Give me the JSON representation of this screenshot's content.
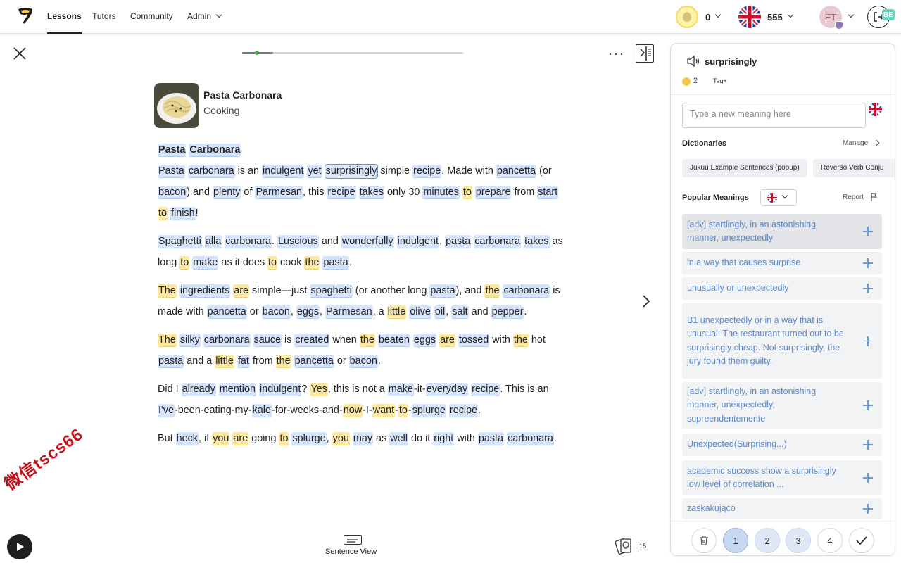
{
  "topbar": {
    "nav": [
      "Lessons",
      "Tutors",
      "Community",
      "Admin"
    ],
    "coins": "0",
    "known_words": "555",
    "avatar_initials": "ET",
    "extension_badge": "BE"
  },
  "lesson": {
    "title": "Pasta Carbonara",
    "category": "Cooking",
    "progress_fraction": 0.14,
    "paragraphs": [
      {
        "heading": true,
        "words": [
          [
            "Pasta",
            "b"
          ],
          [
            " ",
            ""
          ],
          [
            "Carbonara",
            "b"
          ]
        ]
      },
      {
        "words": [
          [
            "Pasta",
            "b"
          ],
          [
            " ",
            ""
          ],
          [
            "carbonara",
            "b"
          ],
          [
            " is an ",
            ""
          ],
          [
            "indulgent",
            "b"
          ],
          [
            " ",
            ""
          ],
          [
            "yet",
            "b"
          ],
          [
            " ",
            ""
          ],
          [
            "surprisingly",
            "sel"
          ],
          [
            " simple ",
            ""
          ],
          [
            "recipe",
            "b"
          ],
          [
            ".  Made with ",
            ""
          ],
          [
            "pancetta",
            "b"
          ],
          [
            " (or ",
            ""
          ],
          [
            "bacon",
            "b"
          ],
          [
            ") and ",
            ""
          ],
          [
            "plenty",
            "b"
          ],
          [
            " of ",
            ""
          ],
          [
            "Parmesan",
            "b"
          ],
          [
            ", this ",
            ""
          ],
          [
            "recipe",
            "b"
          ],
          [
            " ",
            ""
          ],
          [
            "takes",
            "b"
          ],
          [
            " only 30 ",
            ""
          ],
          [
            "minutes",
            "b"
          ],
          [
            " ",
            ""
          ],
          [
            "to",
            "y"
          ],
          [
            " ",
            ""
          ],
          [
            "prepare",
            "b"
          ],
          [
            " from ",
            ""
          ],
          [
            "start",
            "b"
          ],
          [
            " ",
            ""
          ],
          [
            "to",
            "y"
          ],
          [
            " ",
            ""
          ],
          [
            "finish",
            "b"
          ],
          [
            "!",
            ""
          ]
        ]
      },
      {
        "words": [
          [
            "Spaghetti",
            "b"
          ],
          [
            " ",
            ""
          ],
          [
            "alla",
            "b"
          ],
          [
            " ",
            ""
          ],
          [
            "carbonara",
            "b"
          ],
          [
            ".  ",
            ""
          ],
          [
            "Luscious",
            "b"
          ],
          [
            " and ",
            ""
          ],
          [
            "wonderfully",
            "b"
          ],
          [
            " ",
            ""
          ],
          [
            "indulgent",
            "b"
          ],
          [
            ", ",
            ""
          ],
          [
            "pasta",
            "b"
          ],
          [
            " ",
            ""
          ],
          [
            "carbonara",
            "b"
          ],
          [
            " ",
            ""
          ],
          [
            "takes",
            "b"
          ],
          [
            " as long ",
            ""
          ],
          [
            "to",
            "y"
          ],
          [
            " ",
            ""
          ],
          [
            "make",
            "b"
          ],
          [
            " as it does ",
            ""
          ],
          [
            "to",
            "y"
          ],
          [
            " cook ",
            ""
          ],
          [
            "the",
            "y"
          ],
          [
            " ",
            ""
          ],
          [
            "pasta",
            "b"
          ],
          [
            ".",
            ""
          ]
        ]
      },
      {
        "words": [
          [
            "The",
            "y"
          ],
          [
            " ",
            ""
          ],
          [
            "ingredients",
            "b"
          ],
          [
            " ",
            ""
          ],
          [
            "are",
            "y"
          ],
          [
            " simple—just ",
            ""
          ],
          [
            "spaghetti",
            "b"
          ],
          [
            " (or another long ",
            ""
          ],
          [
            "pasta",
            "b"
          ],
          [
            "), and ",
            ""
          ],
          [
            "the",
            "y"
          ],
          [
            " ",
            ""
          ],
          [
            "carbonara",
            "b"
          ],
          [
            " is made with ",
            ""
          ],
          [
            "pancetta",
            "b"
          ],
          [
            " or ",
            ""
          ],
          [
            "bacon",
            "b"
          ],
          [
            ", ",
            ""
          ],
          [
            "eggs",
            "b"
          ],
          [
            ", ",
            ""
          ],
          [
            "Parmesan",
            "b"
          ],
          [
            ", a ",
            ""
          ],
          [
            "little",
            "y"
          ],
          [
            " ",
            ""
          ],
          [
            "olive",
            "b"
          ],
          [
            " ",
            ""
          ],
          [
            "oil",
            "b"
          ],
          [
            ", ",
            ""
          ],
          [
            "salt",
            "b"
          ],
          [
            " and ",
            ""
          ],
          [
            "pepper",
            "b"
          ],
          [
            ".",
            ""
          ]
        ]
      },
      {
        "words": [
          [
            "The",
            "y"
          ],
          [
            " ",
            ""
          ],
          [
            "silky",
            "b"
          ],
          [
            " ",
            ""
          ],
          [
            "carbonara",
            "b"
          ],
          [
            " ",
            ""
          ],
          [
            "sauce",
            "b"
          ],
          [
            " is ",
            ""
          ],
          [
            "created",
            "b"
          ],
          [
            " when ",
            ""
          ],
          [
            "the",
            "y"
          ],
          [
            " ",
            ""
          ],
          [
            "beaten",
            "b"
          ],
          [
            " ",
            ""
          ],
          [
            "eggs",
            "b"
          ],
          [
            " ",
            ""
          ],
          [
            "are",
            "y"
          ],
          [
            " ",
            ""
          ],
          [
            "tossed",
            "b"
          ],
          [
            " with ",
            ""
          ],
          [
            "the",
            "y"
          ],
          [
            " hot ",
            ""
          ],
          [
            "pasta",
            "b"
          ],
          [
            " and a ",
            ""
          ],
          [
            "little",
            "y"
          ],
          [
            " ",
            ""
          ],
          [
            "fat",
            "b"
          ],
          [
            " from ",
            ""
          ],
          [
            "the",
            "y"
          ],
          [
            " ",
            ""
          ],
          [
            "pancetta",
            "b"
          ],
          [
            " or ",
            ""
          ],
          [
            "bacon",
            "b"
          ],
          [
            ".",
            ""
          ]
        ]
      },
      {
        "words": [
          [
            "Did I ",
            ""
          ],
          [
            "already",
            "b"
          ],
          [
            " ",
            ""
          ],
          [
            "mention",
            "b"
          ],
          [
            " ",
            ""
          ],
          [
            "indulgent",
            "b"
          ],
          [
            "?  ",
            ""
          ],
          [
            "Yes",
            "y"
          ],
          [
            ", this is not a ",
            ""
          ],
          [
            "make",
            "b"
          ],
          [
            "-it-",
            ""
          ],
          [
            "everyday",
            "b"
          ],
          [
            " ",
            ""
          ],
          [
            "recipe",
            "b"
          ],
          [
            ".  This is an ",
            ""
          ],
          [
            "I've",
            "b"
          ],
          [
            "-been-eating-my-",
            ""
          ],
          [
            "kale",
            "b"
          ],
          [
            "-for-weeks-and-",
            ""
          ],
          [
            "now",
            "y"
          ],
          [
            "-I-",
            ""
          ],
          [
            "want",
            "y"
          ],
          [
            "-",
            ""
          ],
          [
            "to",
            "y"
          ],
          [
            "-",
            ""
          ],
          [
            "splurge",
            "b"
          ],
          [
            " ",
            ""
          ],
          [
            "recipe",
            "b"
          ],
          [
            ".",
            ""
          ]
        ]
      },
      {
        "words": [
          [
            "But ",
            ""
          ],
          [
            "heck",
            "b"
          ],
          [
            ", if ",
            ""
          ],
          [
            "you",
            "y"
          ],
          [
            " ",
            ""
          ],
          [
            "are",
            "y"
          ],
          [
            " going ",
            ""
          ],
          [
            "to",
            "y"
          ],
          [
            " ",
            ""
          ],
          [
            "splurge",
            "b"
          ],
          [
            ", ",
            ""
          ],
          [
            "you",
            "y"
          ],
          [
            " ",
            ""
          ],
          [
            "may",
            "b"
          ],
          [
            " as ",
            ""
          ],
          [
            "well",
            "b"
          ],
          [
            " do it ",
            ""
          ],
          [
            "right",
            "b"
          ],
          [
            " with ",
            ""
          ],
          [
            "pasta",
            "b"
          ],
          [
            " ",
            ""
          ],
          [
            "carbonara",
            "b"
          ],
          [
            ".",
            ""
          ]
        ]
      }
    ],
    "sentence_view_label": "Sentence View",
    "cards_count": "15",
    "watermark": "微信tscs66"
  },
  "sidebar": {
    "word": "surprisingly",
    "level": "2",
    "tag_label": "Tag+",
    "meaning_placeholder": "Type a new meaning here",
    "dictionaries_label": "Dictionaries",
    "manage_label": "Manage",
    "dictionaries": [
      "Jukuu Example Sentences (popup)",
      "Reverso Verb Conju"
    ],
    "popular_label": "Popular Meanings",
    "report_label": "Report",
    "meanings": [
      "[adv] startlingly, in an astonishing manner, unexpectedly",
      "in a way that causes surprise",
      "unusually or unexpectedly",
      "B1 unexpectedly or in a way that is unusual: The restaurant turned out to be surprisingly cheap. Not surprisingly, the jury found them guilty.",
      "[adv] startlingly, in an astonishing manner, unexpectedly, supreendentemente",
      "Unexpected(Surprising...)",
      "academic success show a surprisingly low level of correlation ...",
      "zaskakująco"
    ],
    "levels": [
      "1",
      "2",
      "3",
      "4"
    ]
  }
}
